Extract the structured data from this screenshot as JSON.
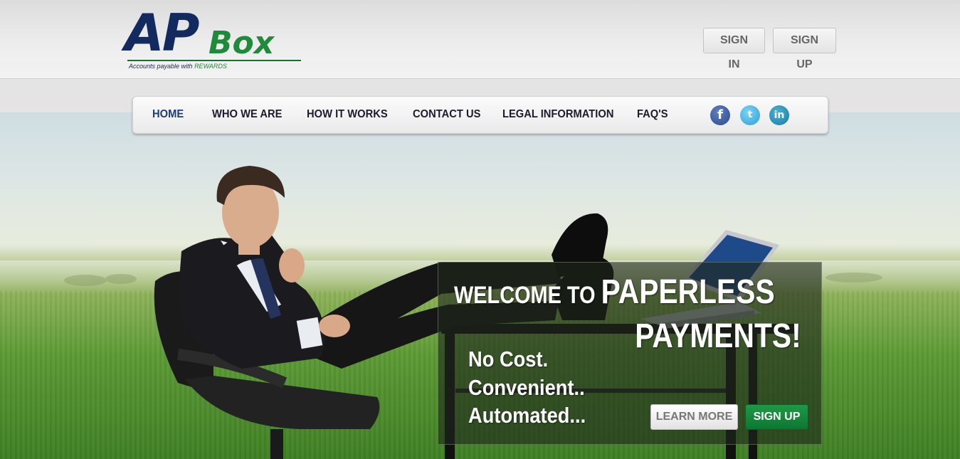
{
  "brand": {
    "logo_main": "AP",
    "logo_secondary": "Box",
    "tagline_prefix": "Accounts payable with ",
    "tagline_highlight": "REWARDS",
    "colors": {
      "navy": "#132a5e",
      "green": "#1f8a3a"
    }
  },
  "header": {
    "sign_in_label": "SIGN IN",
    "sign_up_label": "SIGN UP"
  },
  "nav": {
    "items": [
      {
        "label": "HOME",
        "active": true
      },
      {
        "label": "WHO WE ARE"
      },
      {
        "label": "HOW IT WORKS"
      },
      {
        "label": "CONTACT US"
      },
      {
        "label": "LEGAL INFORMATION"
      },
      {
        "label": "FAQ'S"
      }
    ],
    "social": [
      {
        "icon": "facebook-icon",
        "glyph": "f"
      },
      {
        "icon": "twitter-icon",
        "glyph": "t"
      },
      {
        "icon": "linkedin-icon",
        "glyph": "in"
      }
    ]
  },
  "hero": {
    "welcome_small": "WELCOME TO ",
    "welcome_big": "PAPERLESS",
    "welcome_line2": "PAYMENTS!",
    "taglines": [
      "No Cost.",
      "Convenient..",
      "Automated..."
    ],
    "learn_more_label": "LEARN MORE",
    "sign_up_label": "SIGN UP"
  }
}
